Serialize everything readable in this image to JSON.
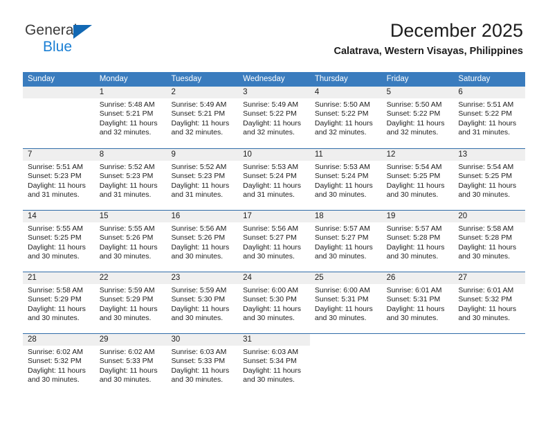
{
  "brand": {
    "name_top": "General",
    "name_bottom": "Blue",
    "triangle_color": "#1268b3",
    "blue_color": "#1a7fd4"
  },
  "header": {
    "title": "December 2025",
    "subtitle": "Calatrava, Western Visayas, Philippines"
  },
  "theme": {
    "header_bg": "#3a7cbe",
    "header_text": "#ffffff",
    "row_divider": "#2f6ca8",
    "daynum_band": "#efefef",
    "text": "#1c1c1c"
  },
  "weekdays": [
    "Sunday",
    "Monday",
    "Tuesday",
    "Wednesday",
    "Thursday",
    "Friday",
    "Saturday"
  ],
  "labels": {
    "sunrise_prefix": "Sunrise:",
    "sunset_prefix": "Sunset:",
    "daylight_prefix": "Daylight:"
  },
  "weeks": [
    {
      "days": [
        {
          "number": "",
          "sunrise": "",
          "sunset": "",
          "daylight_line1": "",
          "daylight_line2": "",
          "empty": true
        },
        {
          "number": "1",
          "sunrise": "Sunrise: 5:48 AM",
          "sunset": "Sunset: 5:21 PM",
          "daylight_line1": "Daylight: 11 hours",
          "daylight_line2": "and 32 minutes."
        },
        {
          "number": "2",
          "sunrise": "Sunrise: 5:49 AM",
          "sunset": "Sunset: 5:21 PM",
          "daylight_line1": "Daylight: 11 hours",
          "daylight_line2": "and 32 minutes."
        },
        {
          "number": "3",
          "sunrise": "Sunrise: 5:49 AM",
          "sunset": "Sunset: 5:22 PM",
          "daylight_line1": "Daylight: 11 hours",
          "daylight_line2": "and 32 minutes."
        },
        {
          "number": "4",
          "sunrise": "Sunrise: 5:50 AM",
          "sunset": "Sunset: 5:22 PM",
          "daylight_line1": "Daylight: 11 hours",
          "daylight_line2": "and 32 minutes."
        },
        {
          "number": "5",
          "sunrise": "Sunrise: 5:50 AM",
          "sunset": "Sunset: 5:22 PM",
          "daylight_line1": "Daylight: 11 hours",
          "daylight_line2": "and 32 minutes."
        },
        {
          "number": "6",
          "sunrise": "Sunrise: 5:51 AM",
          "sunset": "Sunset: 5:22 PM",
          "daylight_line1": "Daylight: 11 hours",
          "daylight_line2": "and 31 minutes."
        }
      ]
    },
    {
      "days": [
        {
          "number": "7",
          "sunrise": "Sunrise: 5:51 AM",
          "sunset": "Sunset: 5:23 PM",
          "daylight_line1": "Daylight: 11 hours",
          "daylight_line2": "and 31 minutes."
        },
        {
          "number": "8",
          "sunrise": "Sunrise: 5:52 AM",
          "sunset": "Sunset: 5:23 PM",
          "daylight_line1": "Daylight: 11 hours",
          "daylight_line2": "and 31 minutes."
        },
        {
          "number": "9",
          "sunrise": "Sunrise: 5:52 AM",
          "sunset": "Sunset: 5:23 PM",
          "daylight_line1": "Daylight: 11 hours",
          "daylight_line2": "and 31 minutes."
        },
        {
          "number": "10",
          "sunrise": "Sunrise: 5:53 AM",
          "sunset": "Sunset: 5:24 PM",
          "daylight_line1": "Daylight: 11 hours",
          "daylight_line2": "and 31 minutes."
        },
        {
          "number": "11",
          "sunrise": "Sunrise: 5:53 AM",
          "sunset": "Sunset: 5:24 PM",
          "daylight_line1": "Daylight: 11 hours",
          "daylight_line2": "and 30 minutes."
        },
        {
          "number": "12",
          "sunrise": "Sunrise: 5:54 AM",
          "sunset": "Sunset: 5:25 PM",
          "daylight_line1": "Daylight: 11 hours",
          "daylight_line2": "and 30 minutes."
        },
        {
          "number": "13",
          "sunrise": "Sunrise: 5:54 AM",
          "sunset": "Sunset: 5:25 PM",
          "daylight_line1": "Daylight: 11 hours",
          "daylight_line2": "and 30 minutes."
        }
      ]
    },
    {
      "days": [
        {
          "number": "14",
          "sunrise": "Sunrise: 5:55 AM",
          "sunset": "Sunset: 5:25 PM",
          "daylight_line1": "Daylight: 11 hours",
          "daylight_line2": "and 30 minutes."
        },
        {
          "number": "15",
          "sunrise": "Sunrise: 5:55 AM",
          "sunset": "Sunset: 5:26 PM",
          "daylight_line1": "Daylight: 11 hours",
          "daylight_line2": "and 30 minutes."
        },
        {
          "number": "16",
          "sunrise": "Sunrise: 5:56 AM",
          "sunset": "Sunset: 5:26 PM",
          "daylight_line1": "Daylight: 11 hours",
          "daylight_line2": "and 30 minutes."
        },
        {
          "number": "17",
          "sunrise": "Sunrise: 5:56 AM",
          "sunset": "Sunset: 5:27 PM",
          "daylight_line1": "Daylight: 11 hours",
          "daylight_line2": "and 30 minutes."
        },
        {
          "number": "18",
          "sunrise": "Sunrise: 5:57 AM",
          "sunset": "Sunset: 5:27 PM",
          "daylight_line1": "Daylight: 11 hours",
          "daylight_line2": "and 30 minutes."
        },
        {
          "number": "19",
          "sunrise": "Sunrise: 5:57 AM",
          "sunset": "Sunset: 5:28 PM",
          "daylight_line1": "Daylight: 11 hours",
          "daylight_line2": "and 30 minutes."
        },
        {
          "number": "20",
          "sunrise": "Sunrise: 5:58 AM",
          "sunset": "Sunset: 5:28 PM",
          "daylight_line1": "Daylight: 11 hours",
          "daylight_line2": "and 30 minutes."
        }
      ]
    },
    {
      "days": [
        {
          "number": "21",
          "sunrise": "Sunrise: 5:58 AM",
          "sunset": "Sunset: 5:29 PM",
          "daylight_line1": "Daylight: 11 hours",
          "daylight_line2": "and 30 minutes."
        },
        {
          "number": "22",
          "sunrise": "Sunrise: 5:59 AM",
          "sunset": "Sunset: 5:29 PM",
          "daylight_line1": "Daylight: 11 hours",
          "daylight_line2": "and 30 minutes."
        },
        {
          "number": "23",
          "sunrise": "Sunrise: 5:59 AM",
          "sunset": "Sunset: 5:30 PM",
          "daylight_line1": "Daylight: 11 hours",
          "daylight_line2": "and 30 minutes."
        },
        {
          "number": "24",
          "sunrise": "Sunrise: 6:00 AM",
          "sunset": "Sunset: 5:30 PM",
          "daylight_line1": "Daylight: 11 hours",
          "daylight_line2": "and 30 minutes."
        },
        {
          "number": "25",
          "sunrise": "Sunrise: 6:00 AM",
          "sunset": "Sunset: 5:31 PM",
          "daylight_line1": "Daylight: 11 hours",
          "daylight_line2": "and 30 minutes."
        },
        {
          "number": "26",
          "sunrise": "Sunrise: 6:01 AM",
          "sunset": "Sunset: 5:31 PM",
          "daylight_line1": "Daylight: 11 hours",
          "daylight_line2": "and 30 minutes."
        },
        {
          "number": "27",
          "sunrise": "Sunrise: 6:01 AM",
          "sunset": "Sunset: 5:32 PM",
          "daylight_line1": "Daylight: 11 hours",
          "daylight_line2": "and 30 minutes."
        }
      ]
    },
    {
      "days": [
        {
          "number": "28",
          "sunrise": "Sunrise: 6:02 AM",
          "sunset": "Sunset: 5:32 PM",
          "daylight_line1": "Daylight: 11 hours",
          "daylight_line2": "and 30 minutes."
        },
        {
          "number": "29",
          "sunrise": "Sunrise: 6:02 AM",
          "sunset": "Sunset: 5:33 PM",
          "daylight_line1": "Daylight: 11 hours",
          "daylight_line2": "and 30 minutes."
        },
        {
          "number": "30",
          "sunrise": "Sunrise: 6:03 AM",
          "sunset": "Sunset: 5:33 PM",
          "daylight_line1": "Daylight: 11 hours",
          "daylight_line2": "and 30 minutes."
        },
        {
          "number": "31",
          "sunrise": "Sunrise: 6:03 AM",
          "sunset": "Sunset: 5:34 PM",
          "daylight_line1": "Daylight: 11 hours",
          "daylight_line2": "and 30 minutes."
        },
        {
          "number": "",
          "sunrise": "",
          "sunset": "",
          "daylight_line1": "",
          "daylight_line2": "",
          "blank": true
        },
        {
          "number": "",
          "sunrise": "",
          "sunset": "",
          "daylight_line1": "",
          "daylight_line2": "",
          "blank": true
        },
        {
          "number": "",
          "sunrise": "",
          "sunset": "",
          "daylight_line1": "",
          "daylight_line2": "",
          "blank": true
        }
      ]
    }
  ]
}
